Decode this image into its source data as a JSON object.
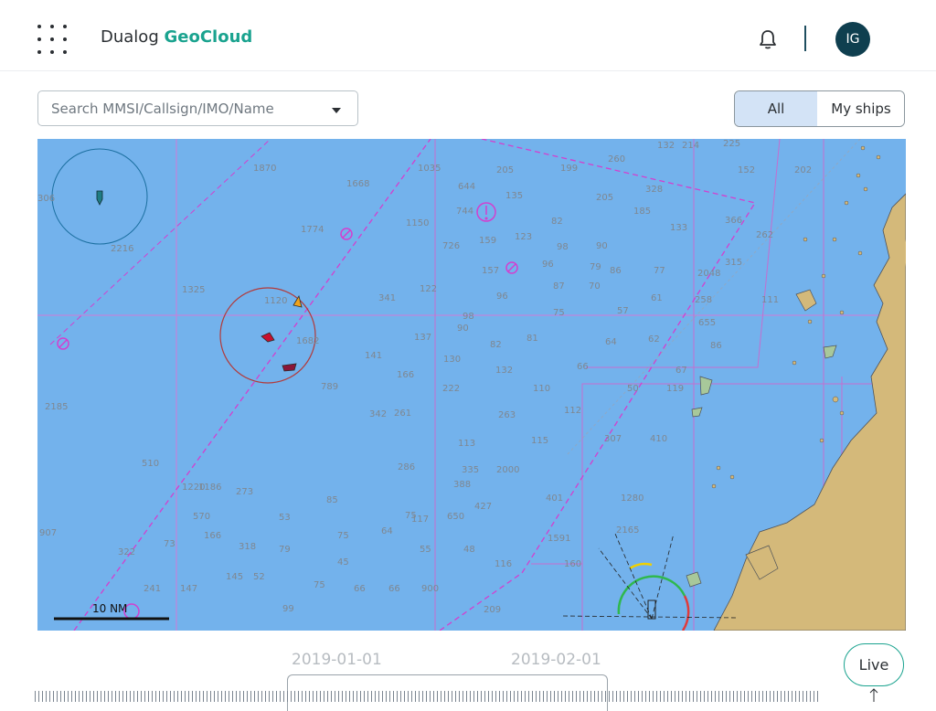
{
  "header": {
    "brand_prefix": "Dualog",
    "brand_name": "GeoCloud",
    "avatar_initials": "IG",
    "icons": [
      "apps-grid-icon",
      "bell-icon"
    ],
    "accent_color": "#1aa38f"
  },
  "search": {
    "placeholder": "Search MMSI/Callsign/IMO/Name"
  },
  "filter": {
    "options": [
      "All",
      "My ships"
    ],
    "selected": "All"
  },
  "map": {
    "scale_label": "10 NM",
    "sea_color": "#73b2ec",
    "land_color": "#d4b97a",
    "depth_soundings": [
      "306",
      "1870",
      "1668",
      "1035",
      "644",
      "205",
      "199",
      "260",
      "132",
      "214",
      "225",
      "152",
      "202",
      "744",
      "135",
      "205",
      "328",
      "2216",
      "1774",
      "1150",
      "185",
      "366",
      "133",
      "262",
      "82",
      "726",
      "159",
      "123",
      "98",
      "90",
      "315",
      "157",
      "96",
      "79",
      "86",
      "77",
      "2048",
      "1325",
      "1120",
      "341",
      "122",
      "96",
      "87",
      "70",
      "61",
      "258",
      "111",
      "98",
      "90",
      "75",
      "57",
      "655",
      "137",
      "82",
      "81",
      "64",
      "62",
      "86",
      "1682",
      "141",
      "166",
      "130",
      "132",
      "66",
      "67",
      "789",
      "222",
      "110",
      "50",
      "119",
      "2185",
      "342",
      "261",
      "263",
      "112",
      "307",
      "410",
      "113",
      "115",
      "510",
      "286",
      "335",
      "2000",
      "1220",
      "1186",
      "273",
      "388",
      "401",
      "1280",
      "85",
      "75",
      "117",
      "650",
      "570",
      "53",
      "427",
      "2165",
      "907",
      "166",
      "318",
      "75",
      "64",
      "55",
      "48",
      "1591",
      "322",
      "73",
      "79",
      "45",
      "116",
      "160",
      "145",
      "52",
      "75",
      "66",
      "66",
      "900",
      "241",
      "147",
      "99",
      "209"
    ]
  },
  "timeline": {
    "dates": [
      "2019-01-01",
      "2019-02-01"
    ],
    "live_label": "Live"
  }
}
